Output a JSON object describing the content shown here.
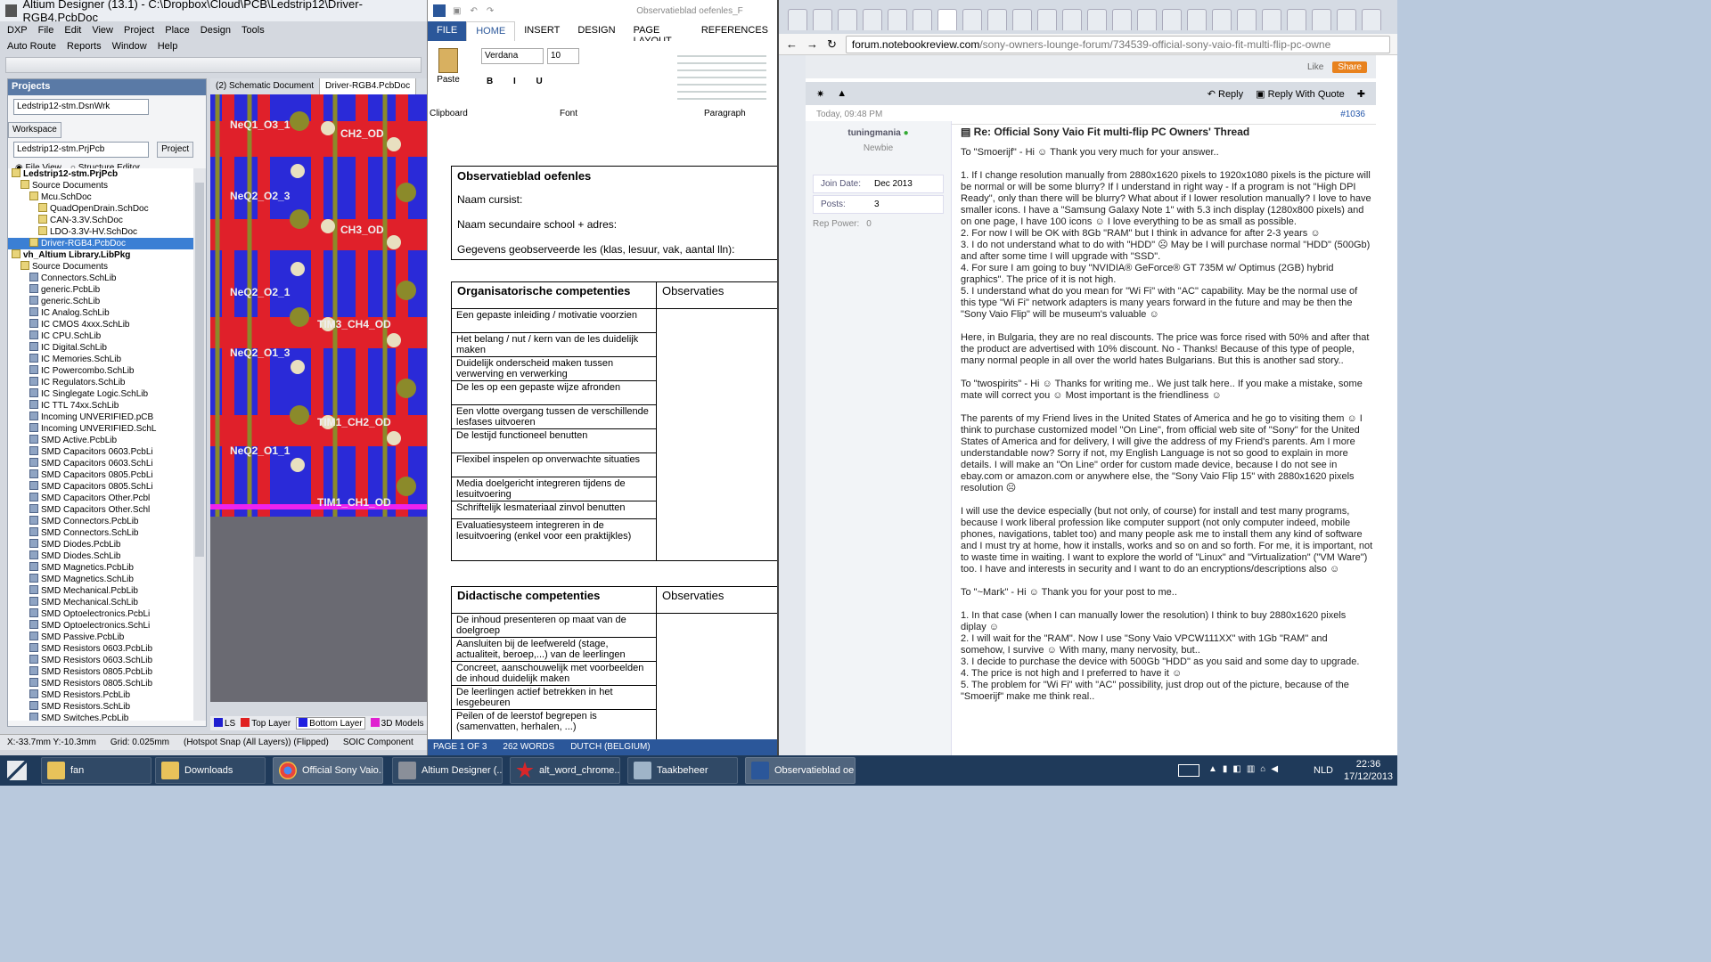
{
  "altium": {
    "title": "Altium Designer (13.1) - C:\\Dropbox\\Cloud\\PCB\\Ledstrip12\\Driver-RGB4.PcbDoc",
    "menus": [
      "DXP",
      "File",
      "Edit",
      "View",
      "Project",
      "Place",
      "Design",
      "Tools",
      "Auto Route",
      "Reports",
      "Window",
      "Help"
    ],
    "panel_title": "Projects",
    "workspace_value": "Ledstrip12-stm.DsnWrk",
    "workspace_btn": "Workspace",
    "project_value": "Ledstrip12-stm.PrjPcb",
    "project_btn": "Project",
    "file_view": "File View",
    "structure_editor": "Structure Editor",
    "tree": [
      {
        "t": "Ledstrip12-stm.PrjPcb",
        "lvl": 1,
        "b": true
      },
      {
        "t": "Source Documents",
        "lvl": 2
      },
      {
        "t": "Mcu.SchDoc",
        "lvl": 3
      },
      {
        "t": "QuadOpenDrain.SchDoc",
        "lvl": 4
      },
      {
        "t": "CAN-3.3V.SchDoc",
        "lvl": 4
      },
      {
        "t": "LDO-3.3V-HV.SchDoc",
        "lvl": 4
      },
      {
        "t": "Driver-RGB4.PcbDoc",
        "lvl": 3,
        "sel": true
      },
      {
        "t": "vh_Altium Library.LibPkg",
        "lvl": 1,
        "b": true
      },
      {
        "t": "Source Documents",
        "lvl": 2
      },
      {
        "t": "Connectors.SchLib",
        "lvl": 3,
        "lib": true
      },
      {
        "t": "generic.PcbLib",
        "lvl": 3,
        "lib": true
      },
      {
        "t": "generic.SchLib",
        "lvl": 3,
        "lib": true
      },
      {
        "t": "IC Analog.SchLib",
        "lvl": 3,
        "lib": true
      },
      {
        "t": "IC CMOS 4xxx.SchLib",
        "lvl": 3,
        "lib": true
      },
      {
        "t": "IC CPU.SchLib",
        "lvl": 3,
        "lib": true
      },
      {
        "t": "IC Digital.SchLib",
        "lvl": 3,
        "lib": true
      },
      {
        "t": "IC Memories.SchLib",
        "lvl": 3,
        "lib": true
      },
      {
        "t": "IC Powercombo.SchLib",
        "lvl": 3,
        "lib": true
      },
      {
        "t": "IC Regulators.SchLib",
        "lvl": 3,
        "lib": true
      },
      {
        "t": "IC Singlegate Logic.SchLib",
        "lvl": 3,
        "lib": true
      },
      {
        "t": "IC TTL 74xx.SchLib",
        "lvl": 3,
        "lib": true
      },
      {
        "t": "Incoming UNVERIFIED.pCB",
        "lvl": 3,
        "lib": true
      },
      {
        "t": "Incoming UNVERIFIED.SchL",
        "lvl": 3,
        "lib": true
      },
      {
        "t": "SMD Active.PcbLib",
        "lvl": 3,
        "lib": true
      },
      {
        "t": "SMD Capacitors 0603.PcbLi",
        "lvl": 3,
        "lib": true
      },
      {
        "t": "SMD Capacitors 0603.SchLi",
        "lvl": 3,
        "lib": true
      },
      {
        "t": "SMD Capacitors 0805.PcbLi",
        "lvl": 3,
        "lib": true
      },
      {
        "t": "SMD Capacitors 0805.SchLi",
        "lvl": 3,
        "lib": true
      },
      {
        "t": "SMD Capacitors Other.Pcbl",
        "lvl": 3,
        "lib": true
      },
      {
        "t": "SMD Capacitors Other.Schl",
        "lvl": 3,
        "lib": true
      },
      {
        "t": "SMD Connectors.PcbLib",
        "lvl": 3,
        "lib": true
      },
      {
        "t": "SMD Connectors.SchLib",
        "lvl": 3,
        "lib": true
      },
      {
        "t": "SMD Diodes.PcbLib",
        "lvl": 3,
        "lib": true
      },
      {
        "t": "SMD Diodes.SchLib",
        "lvl": 3,
        "lib": true
      },
      {
        "t": "SMD Magnetics.PcbLib",
        "lvl": 3,
        "lib": true
      },
      {
        "t": "SMD Magnetics.SchLib",
        "lvl": 3,
        "lib": true
      },
      {
        "t": "SMD Mechanical.PcbLib",
        "lvl": 3,
        "lib": true
      },
      {
        "t": "SMD Mechanical.SchLib",
        "lvl": 3,
        "lib": true
      },
      {
        "t": "SMD Optoelectronics.PcbLi",
        "lvl": 3,
        "lib": true
      },
      {
        "t": "SMD Optoelectronics.SchLi",
        "lvl": 3,
        "lib": true
      },
      {
        "t": "SMD Passive.PcbLib",
        "lvl": 3,
        "lib": true
      },
      {
        "t": "SMD Resistors 0603.PcbLib",
        "lvl": 3,
        "lib": true
      },
      {
        "t": "SMD Resistors 0603.SchLib",
        "lvl": 3,
        "lib": true
      },
      {
        "t": "SMD Resistors 0805.PcbLib",
        "lvl": 3,
        "lib": true
      },
      {
        "t": "SMD Resistors 0805.SchLib",
        "lvl": 3,
        "lib": true
      },
      {
        "t": "SMD Resistors.PcbLib",
        "lvl": 3,
        "lib": true
      },
      {
        "t": "SMD Resistors.SchLib",
        "lvl": 3,
        "lib": true
      },
      {
        "t": "SMD Switches.PcbLib",
        "lvl": 3,
        "lib": true
      }
    ],
    "doc_tab1": "(2) Schematic Document",
    "doc_tab2": "Driver-RGB4.PcbDoc",
    "pcb_labels": [
      "NeQ1_O3_1",
      "CH2_OD",
      "NeQ2_O2_3",
      "CH3_OD",
      "NeQ2_O2_1",
      "TIM3_CH4_OD",
      "NeQ2_O1_3",
      "TIM1_CH2_OD",
      "NeQ2_O1_1",
      "TIM1_CH1_OD"
    ],
    "layers": {
      "ls": "LS",
      "top": "Top Layer",
      "bottom": "Bottom Layer",
      "models": "3D Models"
    },
    "status": {
      "coords": "X:-33.7mm Y:-10.3mm",
      "grid": "Grid: 0.025mm",
      "snap": "(Hotspot Snap (All Layers)) (Flipped)",
      "comp": "SOIC Component"
    }
  },
  "word": {
    "tabs": [
      "FILE",
      "HOME",
      "INSERT",
      "DESIGN",
      "PAGE LAYOUT",
      "REFERENCES"
    ],
    "doc_title_fragment": "Observatieblad oefenles_F",
    "font": "Verdana",
    "size": "10",
    "paste": "Paste",
    "groups": [
      "Clipboard",
      "Font",
      "Paragraph"
    ],
    "doc": {
      "heading": "Observatieblad oefenles",
      "l1": "Naam cursist:",
      "l2": "Naam secundaire school + adres:",
      "l3": "Gegevens geobserveerde les (klas, lesuur, vak, aantal lln):",
      "org_h": "Organisatorische competenties",
      "obs": "Observaties",
      "org": [
        "Een gepaste inleiding / motivatie voorzien",
        "Het belang / nut / kern van de les duidelijk maken",
        "Duidelijk onderscheid maken tussen verwerving en verwerking",
        "De les op een gepaste wijze afronden",
        "Een vlotte overgang tussen de verschillende lesfases uitvoeren",
        "De lestijd functioneel benutten",
        "Flexibel inspelen op onverwachte situaties",
        "Media doelgericht integreren tijdens de lesuitvoering",
        "Schriftelijk lesmateriaal zinvol benutten",
        "Evaluatiesysteem integreren in de lesuitvoering (enkel voor een praktijkles)"
      ],
      "did_h": "Didactische competenties",
      "did": [
        "De inhoud presenteren op maat van de doelgroep",
        "Aansluiten bij de leefwereld (stage, actualiteit, beroep,...) van de leerlingen",
        "Concreet, aanschouwelijk met voorbeelden de inhoud duidelijk maken",
        "De leerlingen actief betrekken in het lesgebeuren",
        "Peilen of de leerstof begrepen is (samenvatten, herhalen, ...)"
      ]
    },
    "status": {
      "page": "PAGE 1 OF 3",
      "words": "262 WORDS",
      "lang": "DUTCH (BELGIUM)"
    }
  },
  "chrome": {
    "url_host": "forum.notebookreview.com",
    "url_path": "/sony-owners-lounge-forum/734539-official-sony-vaio-fit-multi-flip-pc-owne",
    "like": "Like",
    "share": "Share",
    "reply": "Reply",
    "reply_quote": "Reply With Quote",
    "date": "Today, 09:48 PM",
    "postnum": "#1036",
    "user": "tuningmania",
    "rank": "Newbie",
    "join_label": "Join Date:",
    "join_value": "Dec 2013",
    "posts_label": "Posts:",
    "posts_value": "3",
    "rep_label": "Rep Power:",
    "rep_value": "0",
    "post_title": "Re: Official Sony Vaio Fit multi-flip PC Owners' Thread",
    "paras": [
      "To \"Smoerijf\" - Hi ☺ Thank you very much for your answer..",
      "1. If I change resolution manually from 2880x1620 pixels to 1920x1080 pixels is the picture will be normal or will be some blurry? If I understand in right way - If a program is not \"High DPI Ready\", only than there will be blurry? What about if I lower resolution manually? I love to have smaller icons. I have a \"Samsung Galaxy Note 1\" with 5.3 inch display (1280x800 pixels) and on one page, I have 100 icons ☺ I love everything to be as small as possible.\n2. For now I will be OK with 8Gb \"RAM\" but I think in advance for after 2-3 years ☺\n3. I do not understand what to do with \"HDD\" ☹ May be I will purchase normal \"HDD\" (500Gb) and after some time I will upgrade with \"SSD\".\n4. For sure I am going to buy \"NVIDIA® GeForce® GT 735M w/ Optimus (2GB) hybrid graphics\". The price of it is not high.\n5. I understand what do you mean for \"Wi Fi\" with \"AC\" capability. May be the normal use of this type \"Wi Fi\" network adapters is many years forward in the future and may be then the \"Sony Vaio Flip\" will be museum's valuable ☺",
      "Here, in Bulgaria, they are no real discounts. The price was force rised with 50% and after that the product are advertised with 10% discount. No - Thanks! Because of this type of people, many normal people in all over the world hates Bulgarians. But this is another sad story..",
      "To \"twospirits\" - Hi ☺ Thanks for writing me.. We just talk here.. If you make a mistake, some mate will correct you ☺ Most important is the friendliness ☺",
      "The parents of my Friend lives in the United States of America and he go to visiting them ☺ I think to purchase customized model \"On Line\", from official web site of \"Sony\" for the United States of America and for delivery, I will give the address of my Friend's parents. Am I more understandable now? Sorry if not, my English Language is not so good to explain in more details. I will make an \"On Line\" order for custom made device, because I do not see in ebay.com or amazon.com or anywhere else, the \"Sony Vaio Flip 15\" with 2880x1620 pixels resolution ☹",
      "I will use the device especially (but not only, of course) for install and test many programs, because I work liberal profession like computer support (not only computer indeed, mobile phones, navigations, tablet too) and many people ask me to install them any kind of software and I must try at home, how it installs, works and so on and so forth. For me, it is important, not to waste time in waiting. I want to explore the world of \"Linux\" and \"Virtualization\" (\"VM Ware\") too. I have and interests in security and I want to do an encryptions/descriptions also ☺",
      "To \"~Mark\" - Hi ☺ Thank you for your post to me..",
      "1. In that case (when I can manually lower the resolution) I think to buy 2880x1620 pixels diplay ☺\n2. I will wait for the \"RAM\". Now I use \"Sony Vaio VPCW111XX\" with 1Gb \"RAM\" and somehow, I survive ☺ With many, many nervosity, but..\n3. I decide to purchase the device with 500Gb \"HDD\" as you said and some day to upgrade.\n4. The price is not high and I preferred to have it ☺\n5. The problem for \"Wi Fi\" with \"AC\" possibility, just drop out of the picture, because of the \"Smoerijf\" make me think real.."
    ]
  },
  "taskbar": {
    "items": [
      "fan",
      "Downloads",
      "Official Sony Vaio...",
      "Altium Designer (...",
      "alt_word_chrome...",
      "Taakbeheer",
      "Observatieblad oe..."
    ],
    "lang": "NLD",
    "time": "22:36",
    "date": "17/12/2013"
  }
}
